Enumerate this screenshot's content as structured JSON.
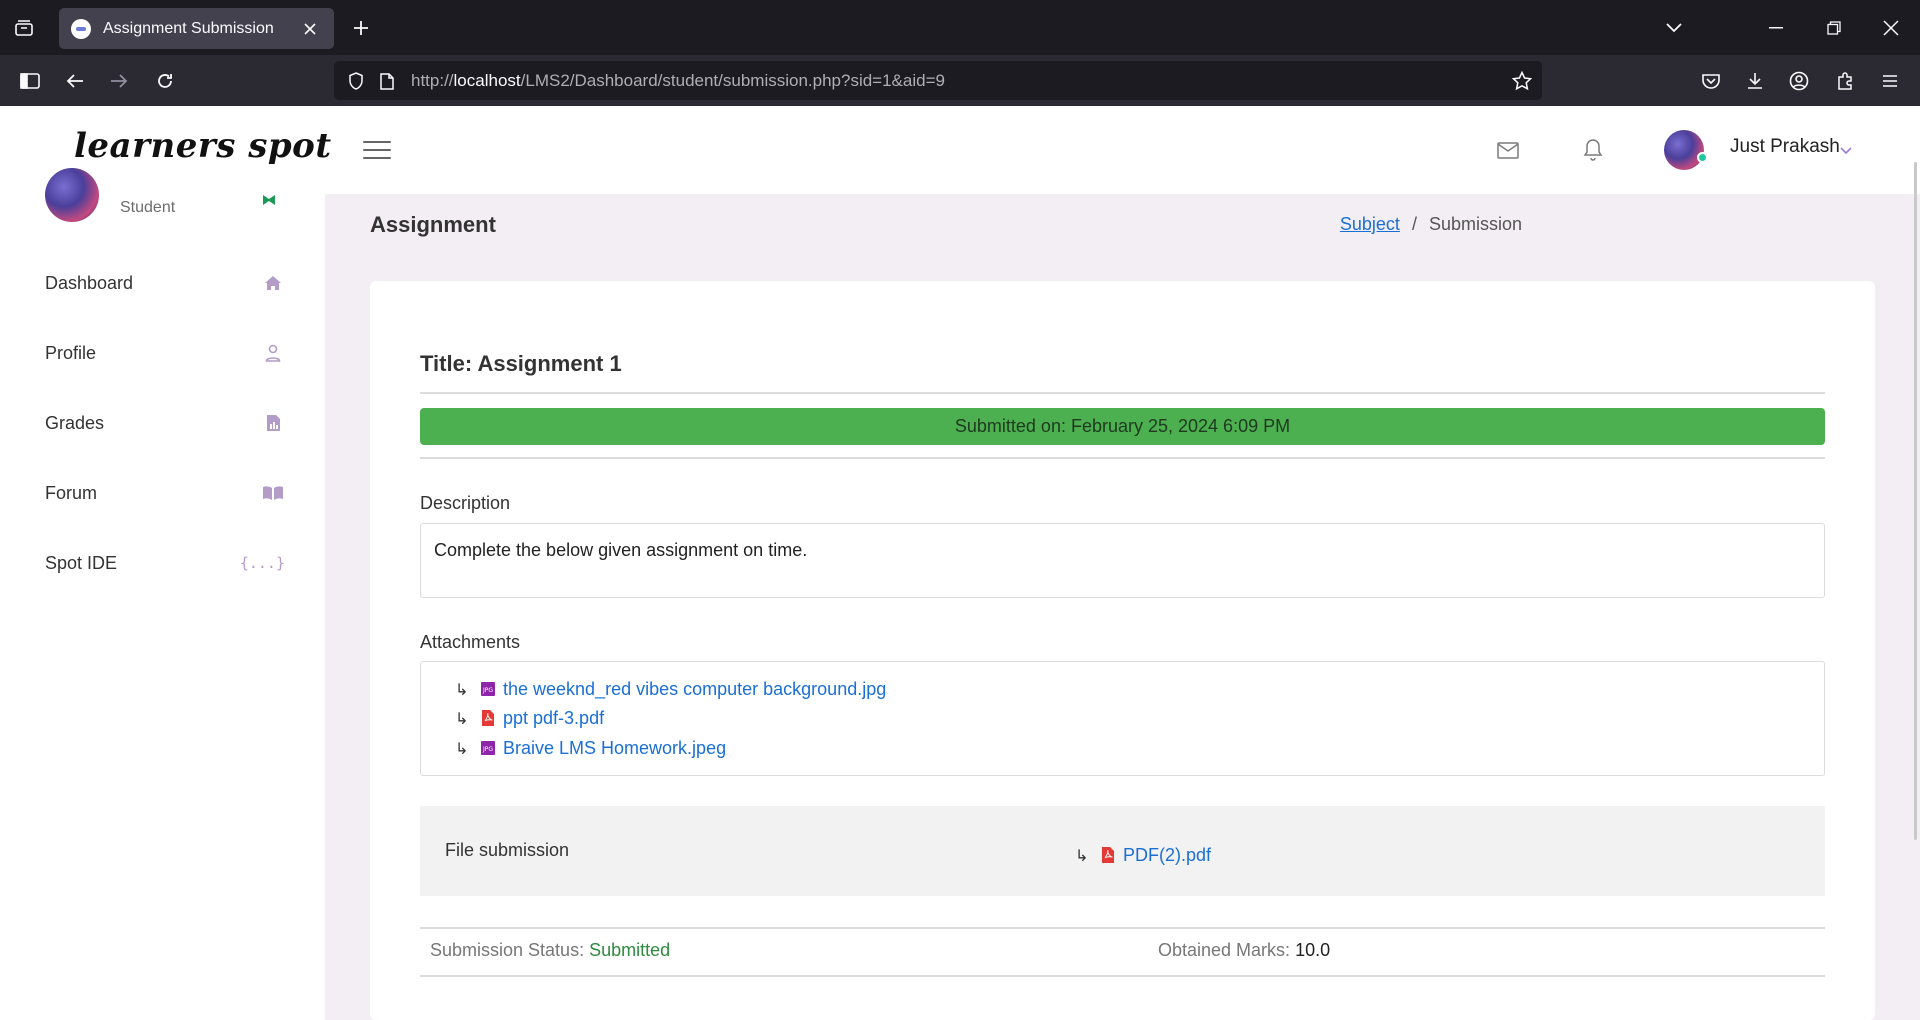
{
  "browser": {
    "tab_title": "Assignment Submission",
    "url_prefix": "http://",
    "url_host": "localhost",
    "url_path": "/LMS2/Dashboard/student/submission.php?sid=1&aid=9"
  },
  "app": {
    "logo_text": "learners spot",
    "user_name": "Just Prakash",
    "role": "Student"
  },
  "sidebar": {
    "items": [
      {
        "label": "Dashboard",
        "icon": "home-icon"
      },
      {
        "label": "Profile",
        "icon": "user-icon"
      },
      {
        "label": "Grades",
        "icon": "report-icon"
      },
      {
        "label": "Forum",
        "icon": "book-icon"
      },
      {
        "label": "Spot IDE",
        "icon": "braces-icon"
      }
    ],
    "spot_ide_glyph": "{...}"
  },
  "page": {
    "heading": "Assignment",
    "breadcrumb_link": "Subject",
    "breadcrumb_sep": "/",
    "breadcrumb_current": "Submission"
  },
  "assignment": {
    "title": "Title: Assignment 1",
    "submitted_on": "Submitted on: February 25, 2024 6:09 PM",
    "description_label": "Description",
    "description": "Complete the below given assignment on time.",
    "attachments_label": "Attachments",
    "attachments": [
      {
        "name": "the weeknd_red vibes computer background.jpg",
        "type": "image"
      },
      {
        "name": "ppt pdf-3.pdf",
        "type": "pdf"
      },
      {
        "name": "Braive LMS Homework.jpeg",
        "type": "image"
      }
    ],
    "file_submission_label": "File submission",
    "submitted_file": "PDF(2).pdf",
    "status_label": "Submission Status:",
    "status_value": "Submitted",
    "marks_label": "Obtained Marks:",
    "marks_value": "10.0"
  },
  "colors": {
    "success_bar": "#4caf50",
    "link": "#1a6fd6",
    "sidebar_icon": "#b39cc8",
    "status_green": "#2e8b3e"
  }
}
